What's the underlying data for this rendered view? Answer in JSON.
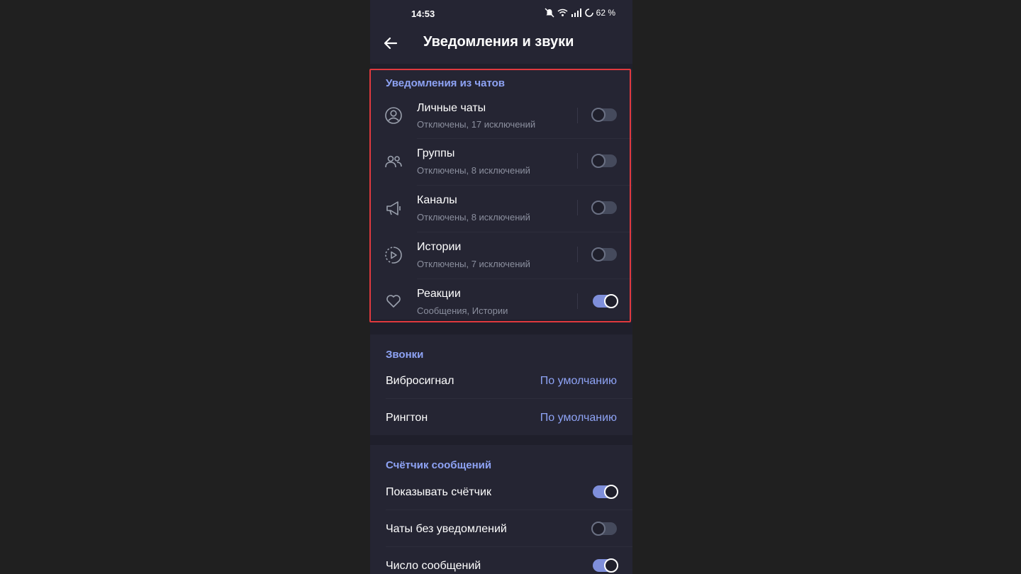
{
  "status_bar": {
    "time": "14:53",
    "battery": "62 %",
    "icons": [
      "mute-icon",
      "wifi-icon",
      "signal-icon",
      "battery-saver-icon"
    ]
  },
  "app_bar": {
    "title": "Уведомления и звуки",
    "back_icon": "arrow-left-icon"
  },
  "chat_notifications": {
    "title": "Уведомления из чатов",
    "items": [
      {
        "label": "Личные чаты",
        "subtitle": "Отключены, 17 исключений",
        "icon": "person-icon",
        "enabled": false
      },
      {
        "label": "Группы",
        "subtitle": "Отключены, 8 исключений",
        "icon": "group-icon",
        "enabled": false
      },
      {
        "label": "Каналы",
        "subtitle": "Отключены, 8 исключений",
        "icon": "megaphone-icon",
        "enabled": false
      },
      {
        "label": "Истории",
        "subtitle": "Отключены, 7 исключений",
        "icon": "stories-icon",
        "enabled": false
      },
      {
        "label": "Реакции",
        "subtitle": "Сообщения, Истории",
        "icon": "heart-icon",
        "enabled": true
      }
    ]
  },
  "calls": {
    "title": "Звонки",
    "items": [
      {
        "label": "Вибросигнал",
        "value": "По умолчанию"
      },
      {
        "label": "Рингтон",
        "value": "По умолчанию"
      }
    ]
  },
  "badge_counter": {
    "title": "Счётчик сообщений",
    "items": [
      {
        "label": "Показывать счётчик",
        "enabled": true
      },
      {
        "label": "Чаты без уведомлений",
        "enabled": false
      },
      {
        "label": "Число сообщений",
        "enabled": true
      }
    ]
  },
  "colors": {
    "accent": "#8ea3f5",
    "highlight_border": "#e0393e",
    "surface": "#252533",
    "background": "#1f1f2b"
  }
}
